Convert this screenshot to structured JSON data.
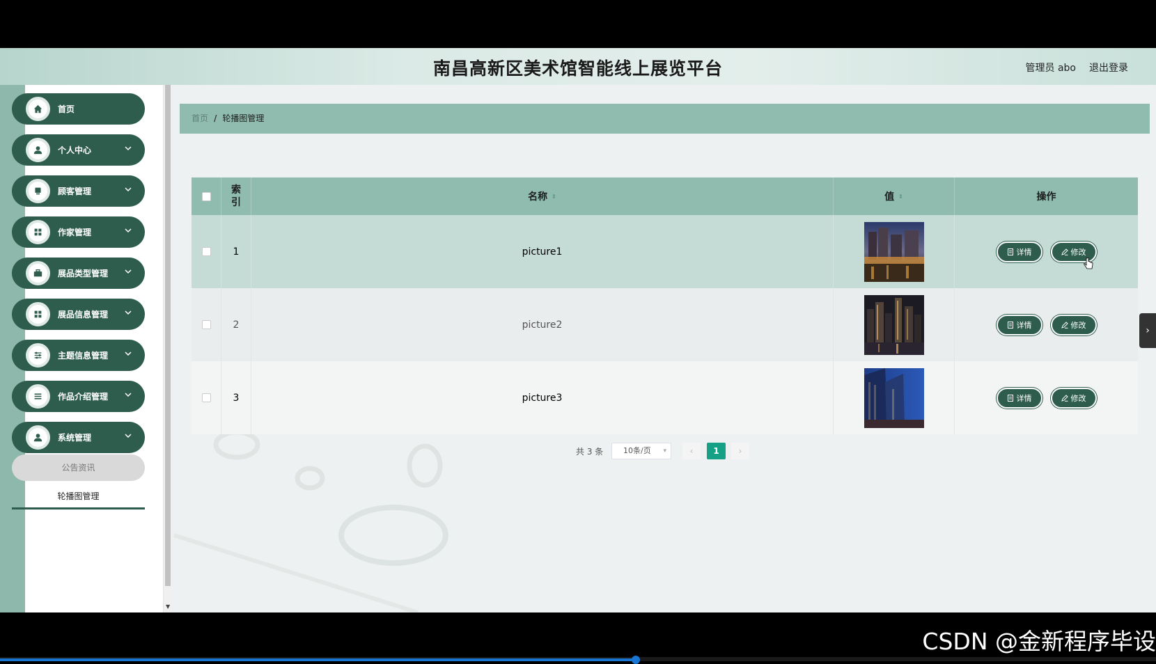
{
  "app": {
    "title": "南昌高新区美术馆智能线上展览平台",
    "user_label": "管理员 abo",
    "logout_label": "退出登录"
  },
  "sidebar": {
    "items": [
      {
        "label": "首页",
        "icon": "home-icon",
        "has_sub": false
      },
      {
        "label": "个人中心",
        "icon": "person-icon",
        "has_sub": true
      },
      {
        "label": "顾客管理",
        "icon": "cup-icon",
        "has_sub": true
      },
      {
        "label": "作家管理",
        "icon": "grid-icon",
        "has_sub": true
      },
      {
        "label": "展品类型管理",
        "icon": "briefcase-icon",
        "has_sub": true
      },
      {
        "label": "展品信息管理",
        "icon": "grid-icon",
        "has_sub": true
      },
      {
        "label": "主题信息管理",
        "icon": "sliders-icon",
        "has_sub": true
      },
      {
        "label": "作品介绍管理",
        "icon": "list-icon",
        "has_sub": true
      },
      {
        "label": "系统管理",
        "icon": "person-icon",
        "has_sub": true
      }
    ],
    "sub_items": [
      {
        "label": "公告资讯"
      },
      {
        "label": "轮播图管理"
      }
    ]
  },
  "breadcrumb": {
    "home": "首页",
    "separator": "/",
    "current": "轮播图管理"
  },
  "table": {
    "headers": {
      "index": "索引",
      "name": "名称",
      "value": "值",
      "ops": "操作"
    },
    "rows": [
      {
        "index": "1",
        "name": "picture1"
      },
      {
        "index": "2",
        "name": "picture2"
      },
      {
        "index": "3",
        "name": "picture3"
      }
    ],
    "detail_label": "详情",
    "edit_label": "修改"
  },
  "pagination": {
    "total": "共 3 条",
    "page_size": "10条/页",
    "current_page": "1"
  },
  "watermark": "CSDN @金新程序毕设",
  "colors": {
    "primary": "#2e5d4d",
    "header_bg": "#8fbcae",
    "active_page": "#16a085"
  },
  "video_progress": 0.55
}
